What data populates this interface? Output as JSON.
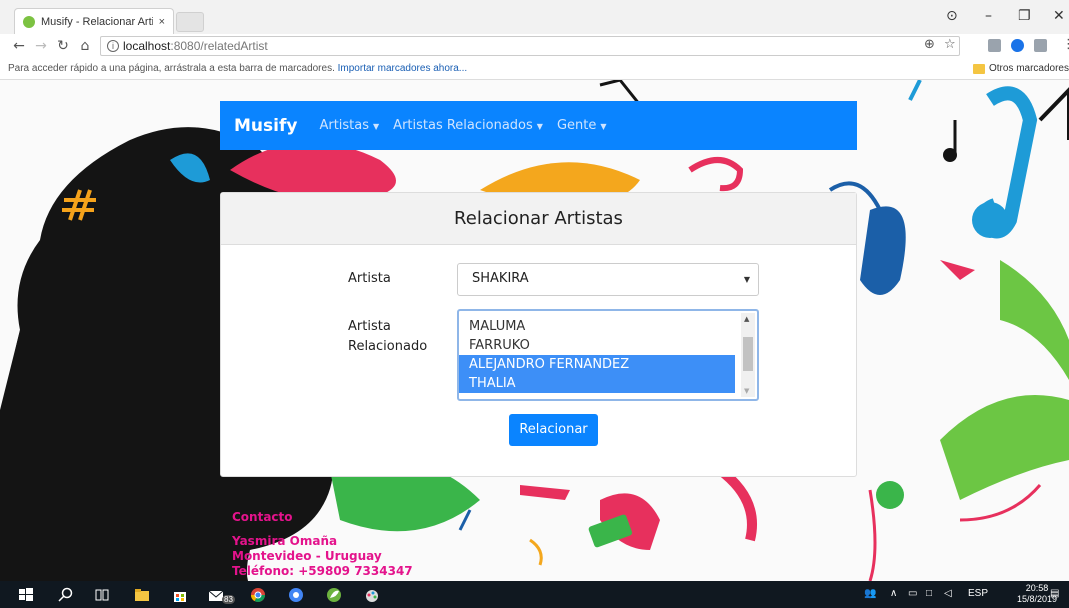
{
  "browser": {
    "tab_title": "Musify - Relacionar Artis",
    "tab_close": "×",
    "url_host": "localhost",
    "url_path": ":8080/relatedArtist",
    "bookmarks_hint": "Para acceder rápido a una página, arrástrala a esta barra de marcadores.",
    "bookmarks_link": "Importar marcadores ahora...",
    "other_bookmarks": "Otros marcadores",
    "icons": [
      "back-icon",
      "forward-icon",
      "reload-icon",
      "home-icon",
      "info-icon",
      "zoom-icon",
      "star-icon",
      "menu-icon",
      "account-icon",
      "minimize-icon",
      "maximize-icon",
      "close-icon"
    ]
  },
  "navbar": {
    "brand": "Musify",
    "links": [
      {
        "label": "Artistas"
      },
      {
        "label": "Artistas Relacionados"
      },
      {
        "label": "Gente"
      }
    ]
  },
  "form": {
    "title": "Relacionar Artistas",
    "artist_label": "Artista",
    "related_label_line1": "Artista",
    "related_label_line2": "Relacionado",
    "artist_selected": "SHAKIRA",
    "related_options": [
      {
        "label": "MALUMA",
        "selected": false
      },
      {
        "label": "FARRUKO",
        "selected": false
      },
      {
        "label": "ALEJANDRO FERNANDEZ",
        "selected": true
      },
      {
        "label": "THALIA",
        "selected": true
      }
    ],
    "submit_label": "Relacionar"
  },
  "footer": {
    "title": "Contacto",
    "name": "Yasmira Omaña",
    "city": "Montevideo - Uruguay",
    "phone": "Teléfono: +59809 7334347"
  },
  "taskbar": {
    "badge_count": "83",
    "tray_lang": "ESP",
    "time": "20:58",
    "date": "15/8/2019"
  },
  "colors": {
    "accent": "#0a84ff",
    "selection": "#3d8ff7",
    "footer_text": "#e4138c"
  }
}
